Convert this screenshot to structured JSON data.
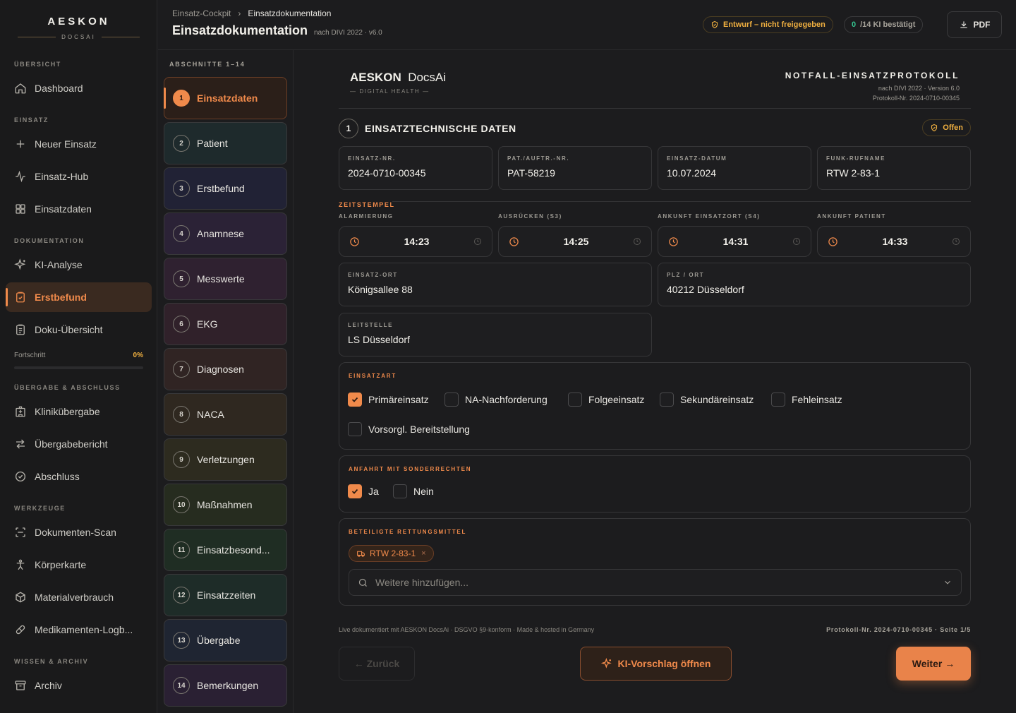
{
  "brand": {
    "name": "AESKON",
    "sub": "DOCSAI"
  },
  "sidebar": {
    "sections": [
      "ÜBERSICHT",
      "EINSATZ",
      "DOKUMENTATION",
      "ÜBERGABE & ABSCHLUSS",
      "WERKZEUGE",
      "WISSEN & ARCHIV"
    ],
    "items": [
      {
        "label": "Dashboard",
        "icon": "home-icon"
      },
      {
        "label": "Neuer Einsatz",
        "icon": "plus-icon"
      },
      {
        "label": "Einsatz-Hub",
        "icon": "activity-icon"
      },
      {
        "label": "Einsatzdaten",
        "icon": "grid-icon"
      },
      {
        "label": "KI-Analyse",
        "icon": "sparkle-icon"
      },
      {
        "label": "Erstbefund",
        "icon": "clipboard-check-icon",
        "active": true
      },
      {
        "label": "Doku-Übersicht",
        "icon": "clipboard-list-icon"
      },
      {
        "label": "Kliniküberg­abe",
        "icon": "hospital-icon"
      },
      {
        "label": "Übergabebericht",
        "icon": "transfer-icon"
      },
      {
        "label": "Abschluss",
        "icon": "check-circle-icon"
      },
      {
        "label": "Dokumenten-Scan",
        "icon": "scan-icon"
      },
      {
        "label": "Körperkarte",
        "icon": "body-icon"
      },
      {
        "label": "Materialverbrauch",
        "icon": "box-icon"
      },
      {
        "label": "Medikamenten-Logb...",
        "icon": "pill-icon"
      },
      {
        "label": "Archiv",
        "icon": "archive-icon"
      }
    ],
    "progress": {
      "label": "Fortschritt",
      "value": "0%",
      "fraction": 0
    }
  },
  "header": {
    "breadcrumb": [
      "Einsatz-Cockpit",
      "Einsatzdokumentation"
    ],
    "title": "Einsatzdokumentation",
    "subtitle": "nach DIVI 2022 · v6.0",
    "draft_badge": "Entwurf – nicht freigegeben",
    "ki_count": "0",
    "ki_text": "/14 KI bestätigt",
    "pdf_label": "PDF"
  },
  "sections_panel": {
    "title": "ABSCHNITTE 1–14",
    "items": [
      {
        "num": "1",
        "label": "Einsatzdaten",
        "active": true
      },
      {
        "num": "2",
        "label": "Patient"
      },
      {
        "num": "3",
        "label": "Erstbefund"
      },
      {
        "num": "4",
        "label": "Anamnese"
      },
      {
        "num": "5",
        "label": "Messwerte"
      },
      {
        "num": "6",
        "label": "EKG"
      },
      {
        "num": "7",
        "label": "Diagnosen"
      },
      {
        "num": "8",
        "label": "NACA"
      },
      {
        "num": "9",
        "label": "Verletzungen"
      },
      {
        "num": "10",
        "label": "Maßnahmen"
      },
      {
        "num": "11",
        "label": "Einsatzbesond..."
      },
      {
        "num": "12",
        "label": "Einsatzzeiten"
      },
      {
        "num": "13",
        "label": "Übergabe"
      },
      {
        "num": "14",
        "label": "Bemerkungen"
      }
    ]
  },
  "doc": {
    "brand_bold": "AESKON",
    "brand_light": "DocsAi",
    "brand_sub": "— DIGITAL HEALTH —",
    "protocol_title": "NOTFALL-EINSATZPROTOKOLL",
    "protocol_sub1": "nach DIVI 2022 · Version 6.0",
    "protocol_sub2": "Protokoll-Nr. 2024-0710-00345",
    "section_num": "1",
    "section_title": "EINSATZTECHNISCHE DATEN",
    "status": "Offen",
    "fields": [
      {
        "label": "EINSATZ-NR.",
        "value": "2024-0710-00345"
      },
      {
        "label": "PAT./AUFTR.-NR.",
        "value": "PAT-58219"
      },
      {
        "label": "EINSATZ-DATUM",
        "value": "10.07.2024"
      },
      {
        "label": "FUNK-RUFNAME",
        "value": "RTW 2-83-1"
      }
    ],
    "timestamps_label": "ZEITSTEMPEL",
    "timestamps": [
      {
        "label": "ALARMIERUNG",
        "value": "14:23"
      },
      {
        "label": "AUSRÜCKEN (S3)",
        "value": "14:25"
      },
      {
        "label": "ANKUNFT EINSATZORT (S4)",
        "value": "14:31"
      },
      {
        "label": "ANKUNFT PATIENT",
        "value": "14:33"
      }
    ],
    "location": {
      "label": "EINSATZ-ORT",
      "value": "Königsallee 88"
    },
    "plz": {
      "label": "PLZ / ORT",
      "value": "40212 Düsseldorf"
    },
    "leitstelle": {
      "label": "LEITSTELLE",
      "value": "LS Düsseldorf"
    },
    "einsatzart": {
      "label": "EINSATZART",
      "options": [
        {
          "label": "Primäreinsatz",
          "checked": true
        },
        {
          "label": "NA-Nachforderung",
          "checked": false
        },
        {
          "label": "Folgeeinsatz",
          "checked": false
        },
        {
          "label": "Sekundäreinsatz",
          "checked": false
        },
        {
          "label": "Fehleinsatz",
          "checked": false
        },
        {
          "label": "Vorsorgl. Bereitstellung",
          "checked": false
        }
      ]
    },
    "sonderrechte": {
      "label": "ANFAHRT MIT SONDERRECHTEN",
      "options": [
        {
          "label": "Ja",
          "checked": true
        },
        {
          "label": "Nein",
          "checked": false
        }
      ]
    },
    "rettungsmittel": {
      "label": "BETEILIGTE RETTUNGSMITTEL",
      "chip": "RTW 2-83-1",
      "placeholder": "Weitere hinzufügen..."
    },
    "footer_left": "Live dokumentiert mit AESKON DocsAi · DSGVO §9-konform · Made & hosted in Germany",
    "footer_right": "Protokoll-Nr. 2024-0710-00345 · Seite 1/5",
    "back_label": "← Zurück",
    "ki_button": "KI-Vorschlag öffnen",
    "next_label": "Weiter →"
  },
  "colors": {
    "accent": "#f08a4b",
    "warning": "#f0b040",
    "success": "#34c38f",
    "background": "#1c1c1e"
  }
}
